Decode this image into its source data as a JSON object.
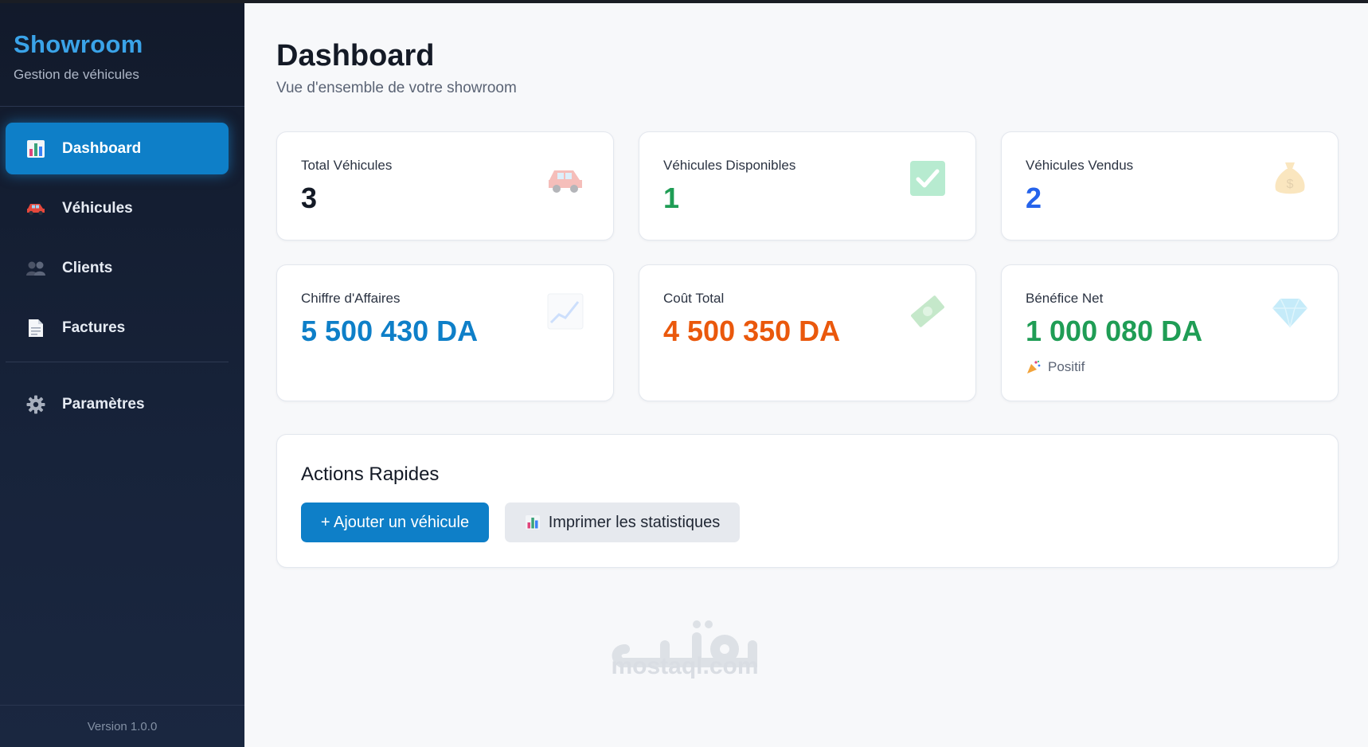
{
  "app": {
    "brand_title": "Showroom",
    "brand_subtitle": "Gestion de véhicules",
    "version": "Version 1.0.0",
    "accent_color": "#0e7fc8"
  },
  "sidebar": {
    "items": [
      {
        "label": "Dashboard",
        "icon": "bar-chart-icon",
        "active": true
      },
      {
        "label": "Véhicules",
        "icon": "car-icon",
        "active": false
      },
      {
        "label": "Clients",
        "icon": "users-icon",
        "active": false
      },
      {
        "label": "Factures",
        "icon": "document-icon",
        "active": false
      }
    ],
    "settings": {
      "label": "Paramètres",
      "icon": "gear-icon"
    }
  },
  "header": {
    "title": "Dashboard",
    "subtitle": "Vue d'ensemble de votre showroom"
  },
  "stats": [
    {
      "label": "Total Véhicules",
      "value": "3",
      "color": "#141a26",
      "icon": "car-icon"
    },
    {
      "label": "Véhicules Disponibles",
      "value": "1",
      "color": "#1f9d55",
      "icon": "checkmark-icon"
    },
    {
      "label": "Véhicules Vendus",
      "value": "2",
      "color": "#2563eb",
      "icon": "money-bag-icon"
    },
    {
      "label": "Chiffre d'Affaires",
      "value": "5 500 430 DA",
      "color": "#0e7fc8",
      "icon": "trend-chart-icon"
    },
    {
      "label": "Coût Total",
      "value": "4 500 350 DA",
      "color": "#ea580c",
      "icon": "banknote-icon"
    },
    {
      "label": "Bénéfice Net",
      "value": "1 000 080 DA",
      "color": "#1f9d55",
      "icon": "diamond-icon",
      "note": "Positif",
      "note_icon": "party-popper-icon"
    }
  ],
  "quick_actions": {
    "title": "Actions Rapides",
    "add_vehicle": "+ Ajouter un véhicule",
    "print_stats": "Imprimer les statistiques",
    "print_stats_icon": "bar-chart-icon"
  },
  "watermark": {
    "text": "mostaql.com"
  }
}
